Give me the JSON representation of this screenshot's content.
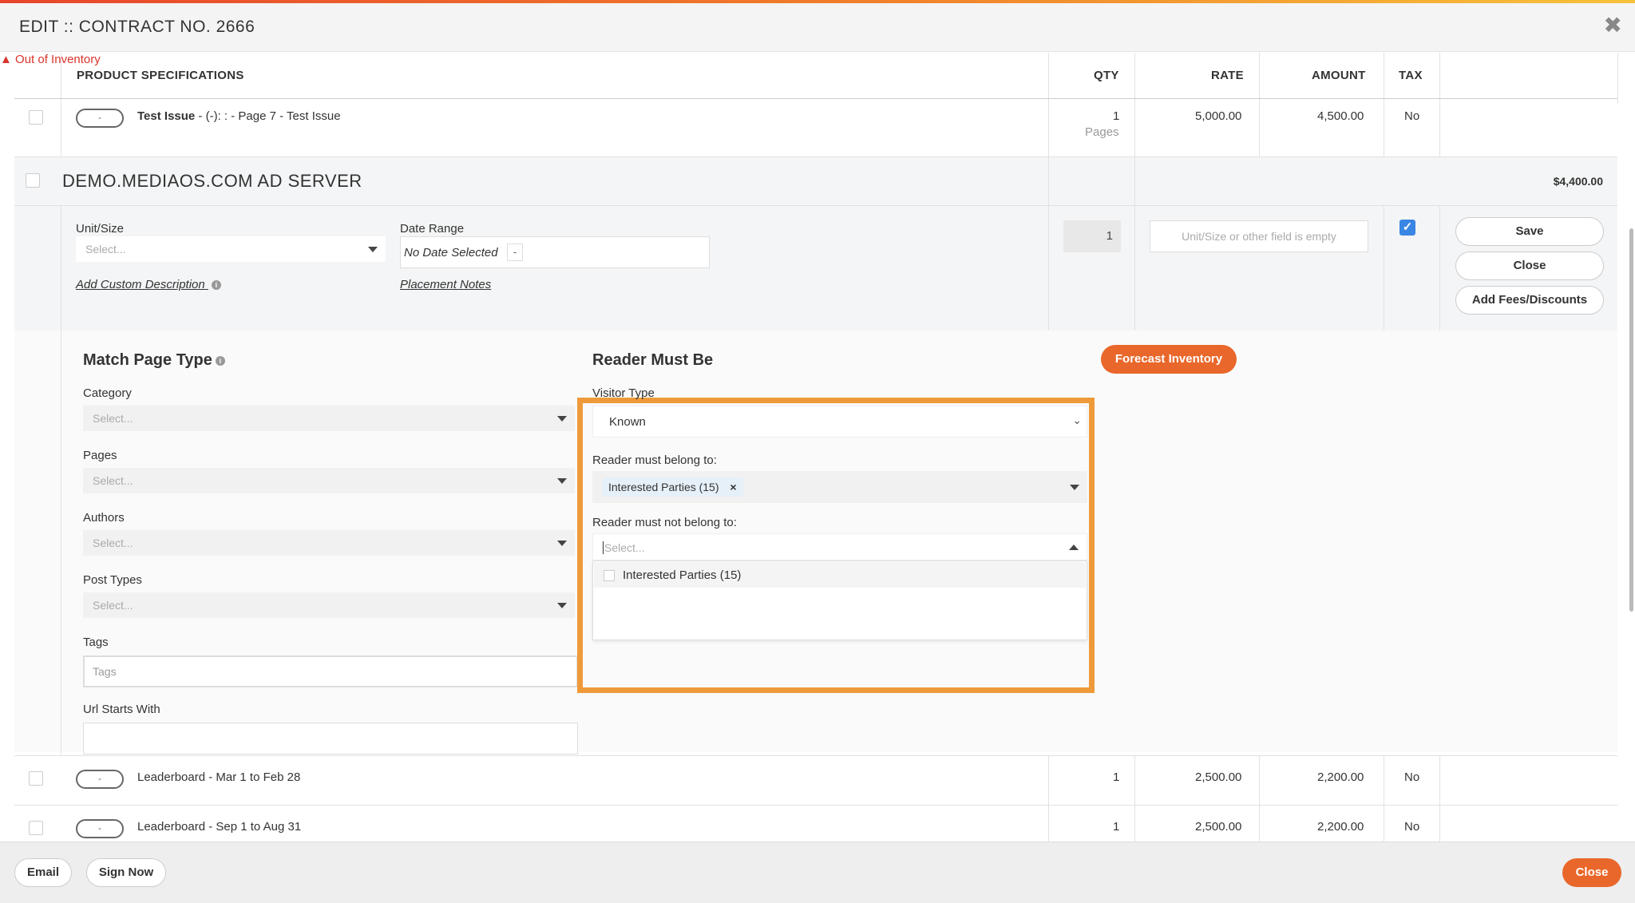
{
  "modal": {
    "title": "EDIT :: CONTRACT NO. 2666"
  },
  "table": {
    "headers": {
      "product": "PRODUCT SPECIFICATIONS",
      "qty": "QTY",
      "rate": "RATE",
      "amount": "AMOUNT",
      "tax": "TAX"
    },
    "rows": [
      {
        "toggle": "-",
        "name": "Test Issue",
        "detail": " - (-): : - Page 7 - Test Issue",
        "warning": "Out of Inventory",
        "qty": "1",
        "qty_unit": "Pages",
        "rate": "5,000.00",
        "amount": "4,500.00",
        "tax": "No"
      },
      {
        "toggle": "-",
        "name": "Leaderboard - Mar 1 to Feb 28",
        "qty": "1",
        "rate": "2,500.00",
        "amount": "2,200.00",
        "tax": "No"
      },
      {
        "toggle": "-",
        "name": "Leaderboard - Sep 1 to Aug 31",
        "qty": "1",
        "rate": "2,500.00",
        "amount": "2,200.00",
        "tax": "No"
      }
    ]
  },
  "section": {
    "name": "DEMO.MEDIAOS.COM AD SERVER",
    "total": "$4,400.00"
  },
  "edit_row": {
    "unit_size_label": "Unit/Size",
    "unit_size_placeholder": "Select...",
    "date_range_label": "Date Range",
    "date_range_value": "No Date Selected",
    "date_range_btn": "-",
    "qty_value": "1",
    "rate_placeholder": "Unit/Size or other field is empty",
    "add_custom_description": "Add Custom Description",
    "placement_notes": "Placement Notes",
    "tax_checked": true,
    "buttons": {
      "save": "Save",
      "close": "Close",
      "add_fees": "Add Fees/Discounts"
    }
  },
  "match_page_type": {
    "title": "Match Page Type",
    "category_label": "Category",
    "category_placeholder": "Select...",
    "pages_label": "Pages",
    "pages_placeholder": "Select...",
    "authors_label": "Authors",
    "authors_placeholder": "Select...",
    "post_types_label": "Post Types",
    "post_types_placeholder": "Select...",
    "tags_label": "Tags",
    "tags_placeholder": "Tags",
    "url_label": "Url Starts With",
    "url_value": ""
  },
  "reader_must_be": {
    "title": "Reader Must Be",
    "visitor_type_label": "Visitor Type",
    "visitor_type_value": "Known",
    "belong_label": "Reader must belong to:",
    "belong_chip": "Interested Parties (15)",
    "belong_chip_remove": "×",
    "not_belong_label": "Reader must not belong to:",
    "not_belong_placeholder": "Select...",
    "not_belong_option": "Interested Parties (15)"
  },
  "forecast_button": "Forecast Inventory",
  "footer": {
    "email": "Email",
    "sign_now": "Sign Now",
    "close": "Close"
  },
  "colors": {
    "accent": "#e9672a",
    "highlight": "#ef9a3a",
    "check": "#3a86e4",
    "warning": "#d9342b"
  }
}
